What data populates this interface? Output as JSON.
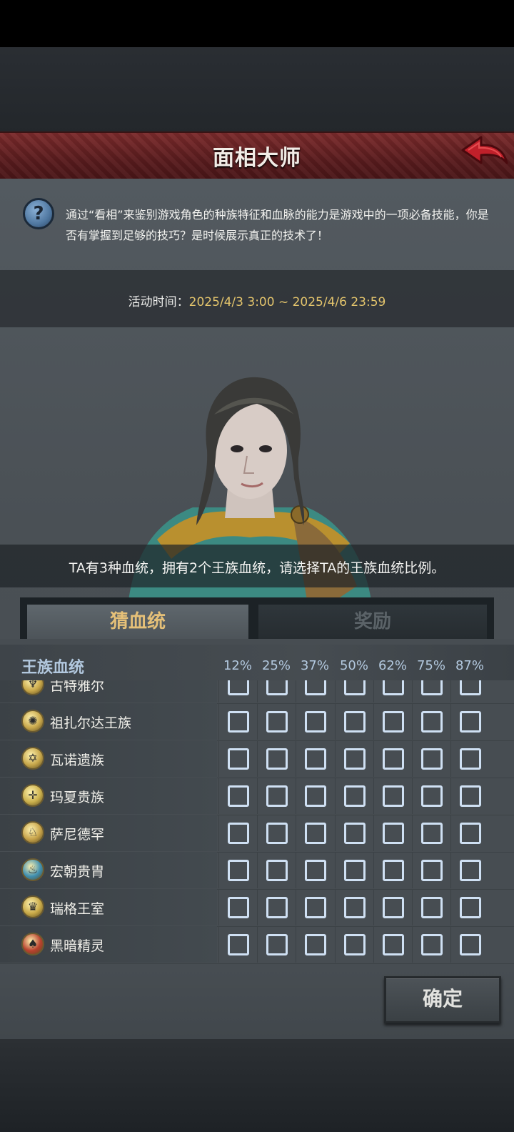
{
  "header": {
    "title": "面相大师",
    "back_icon": "back-arrow-icon"
  },
  "description": {
    "help_icon_glyph": "?",
    "text": "通过“看相”来鉴别游戏角色的种族特征和血脉的能力是游戏中的一项必备技能，你是否有掌握到足够的技巧？是时候展示真正的技术了！"
  },
  "event": {
    "label": "活动时间：",
    "time": "2025/4/3 3:00 ~ 2025/4/6 23:59"
  },
  "question": {
    "text": "TA有3种血统，拥有2个王族血统，请选择TA的王族血统比例。"
  },
  "tabs": [
    {
      "label": "猜血统",
      "active": true
    },
    {
      "label": "奖励",
      "active": false
    }
  ],
  "grid": {
    "header_label": "王族血统",
    "percentages": [
      "12%",
      "25%",
      "37%",
      "50%",
      "62%",
      "75%",
      "87%"
    ],
    "rows": [
      {
        "name": "古特雅尔",
        "icon": "gutyar-crest-icon",
        "icon_color": "#caa94a"
      },
      {
        "name": "祖扎尔达王族",
        "icon": "zuzarda-crest-icon",
        "icon_color": "#c9a84c"
      },
      {
        "name": "瓦诺遗族",
        "icon": "vanuo-star-icon",
        "icon_color": "#c6a64a"
      },
      {
        "name": "玛夏贵族",
        "icon": "masha-compass-icon",
        "icon_color": "#cbb04c"
      },
      {
        "name": "萨尼德罕",
        "icon": "sanidehan-beast-icon",
        "icon_color": "#c7a34a"
      },
      {
        "name": "宏朝贵胄",
        "icon": "hongchao-flame-icon",
        "icon_color": "#3f8fb0"
      },
      {
        "name": "瑞格王室",
        "icon": "ruige-crown-icon",
        "icon_color": "#c8a948"
      },
      {
        "name": "黑暗精灵",
        "icon": "dark-elf-icon",
        "icon_color": "#b8412e"
      }
    ]
  },
  "confirm": {
    "label": "确定"
  },
  "colors": {
    "title_bar": "#6a2426",
    "active_tab_text": "#e5c078",
    "time_value": "#e3c46c",
    "checkbox_border": "#cfe0f3",
    "back_arrow": "#c0202a"
  }
}
